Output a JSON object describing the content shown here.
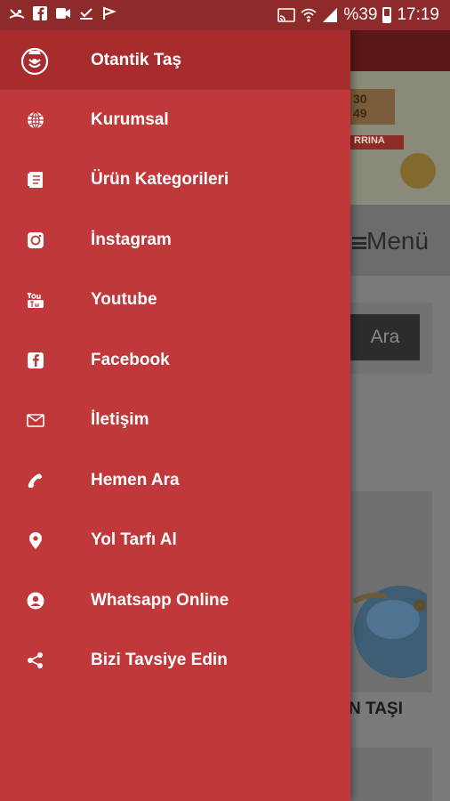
{
  "status_bar": {
    "battery": "%39",
    "time": "17:19",
    "left_icons": [
      "missed-call-icon",
      "facebook-icon",
      "video-icon",
      "download-done-icon",
      "flag-icon"
    ],
    "right_icons": [
      "cast-icon",
      "wifi-icon",
      "signal-icon",
      "battery-icon"
    ]
  },
  "drawer": {
    "header_title": "Otantik Taş",
    "items": [
      {
        "label": "Kurumsal",
        "icon": "globe-icon"
      },
      {
        "label": "Ürün Kategorileri",
        "icon": "book-icon"
      },
      {
        "label": "İnstagram",
        "icon": "instagram-icon"
      },
      {
        "label": "Youtube",
        "icon": "youtube-icon"
      },
      {
        "label": "Facebook",
        "icon": "facebook-icon"
      },
      {
        "label": "İletişim",
        "icon": "envelope-icon"
      },
      {
        "label": "Hemen Ara",
        "icon": "phone-icon"
      },
      {
        "label": "Yol Tarfı Al",
        "icon": "location-pin-icon"
      },
      {
        "label": "Whatsapp Online",
        "icon": "user-circle-icon"
      },
      {
        "label": "Bizi Tavsiye Edin",
        "icon": "share-icon"
      }
    ]
  },
  "background_page": {
    "banner_numbers": "30\n49",
    "banner_text": "RRINA",
    "menu_label": "Menü",
    "search_button": "Ara",
    "product_title": "N TAŞI"
  },
  "colors": {
    "drawer_bg": "#c0383a",
    "drawer_header_bg": "#a82b2d",
    "status_bar_bg": "#8e2a2a"
  }
}
